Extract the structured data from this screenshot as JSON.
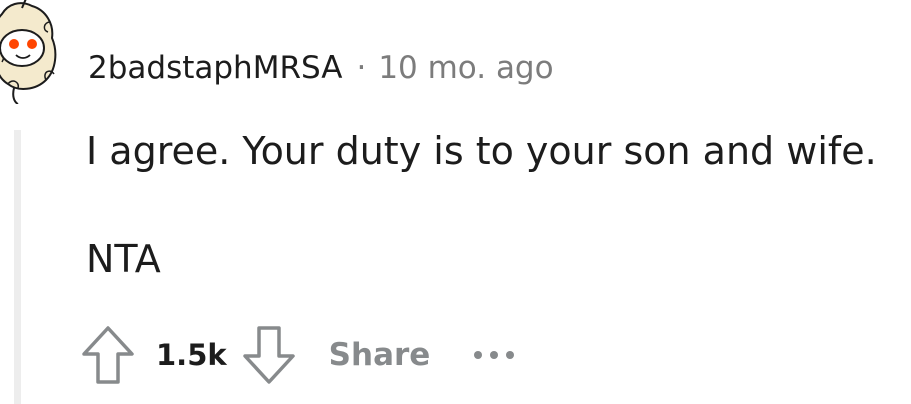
{
  "comment": {
    "author": "2badstaphMRSA",
    "separator": "·",
    "time": "10 mo. ago",
    "body_lines": [
      "I agree. Your duty is to your son and wife.",
      "NTA"
    ]
  },
  "actions": {
    "score": "1.5k",
    "share_label": "Share"
  },
  "icons": {
    "avatar": "snoo-avatar-icon",
    "upvote": "upvote-arrow-icon",
    "downvote": "downvote-arrow-icon",
    "more": "more-options-icon"
  },
  "colors": {
    "text": "#1c1c1c",
    "meta": "#7c7c7c",
    "action_gray": "#878a8c",
    "thread_line": "#ededed",
    "avatar_accent": "#ff4500"
  }
}
